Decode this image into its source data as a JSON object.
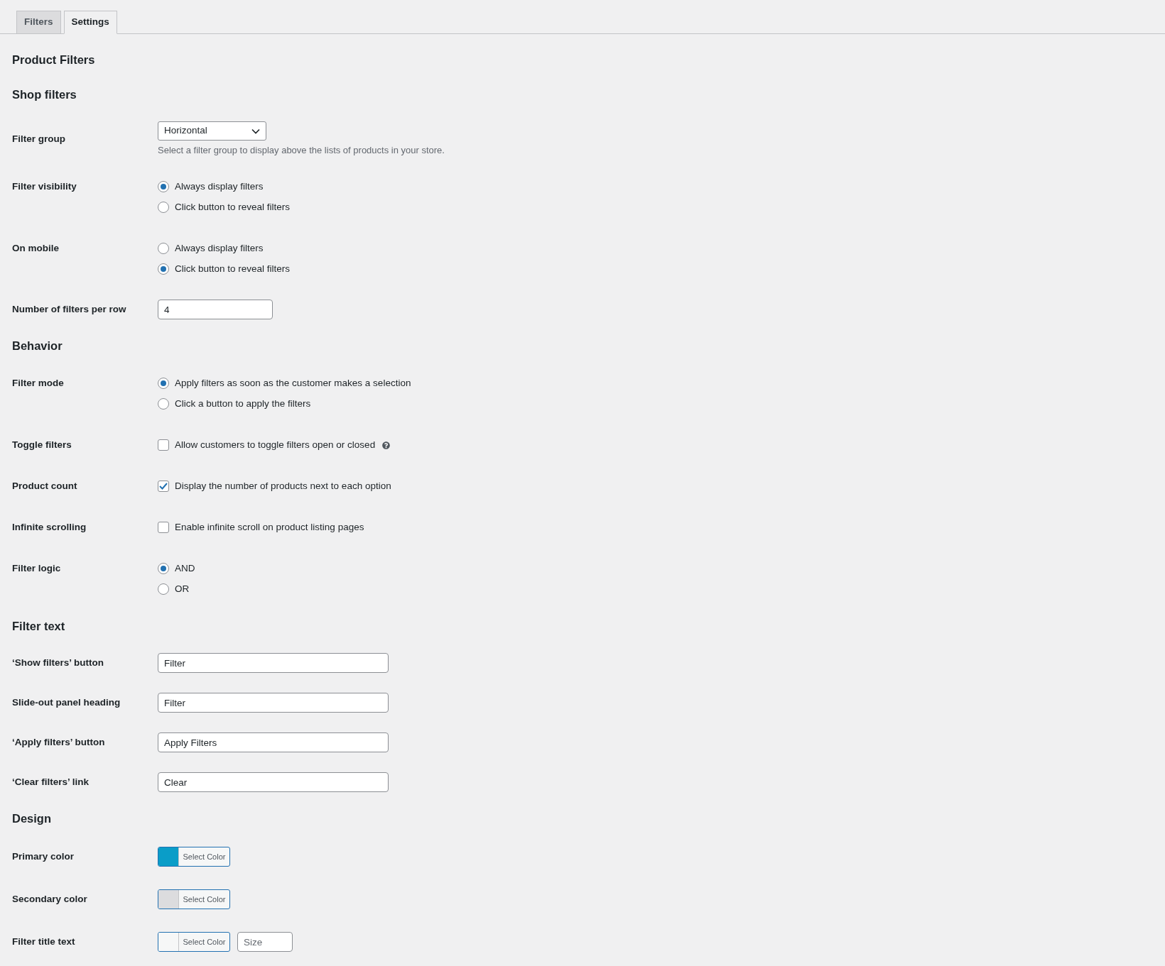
{
  "tabs": [
    {
      "label": "Filters",
      "selected": false
    },
    {
      "label": "Settings",
      "selected": true
    }
  ],
  "title": "Product Filters",
  "sections": [
    {
      "heading": "Shop filters",
      "fields": [
        {
          "kind": "select",
          "label": "Filter group",
          "value": "Horizontal",
          "description": "Select a filter group to display above the lists of products in your store."
        },
        {
          "kind": "radio",
          "label": "Filter visibility",
          "options": [
            {
              "label": "Always display filters",
              "selected": true
            },
            {
              "label": "Click button to reveal filters",
              "selected": false
            }
          ]
        },
        {
          "kind": "radio",
          "label": "On mobile",
          "options": [
            {
              "label": "Always display filters",
              "selected": false
            },
            {
              "label": "Click button to reveal filters",
              "selected": true
            }
          ]
        },
        {
          "kind": "number",
          "label": "Number of filters per row",
          "value": "4"
        }
      ]
    },
    {
      "heading": "Behavior",
      "fields": [
        {
          "kind": "radio",
          "label": "Filter mode",
          "options": [
            {
              "label": "Apply filters as soon as the customer makes a selection",
              "selected": true
            },
            {
              "label": "Click a button to apply the filters",
              "selected": false
            }
          ]
        },
        {
          "kind": "checkbox",
          "label": "Toggle filters",
          "option": "Allow customers to toggle filters open or closed",
          "checked": false,
          "help": true
        },
        {
          "kind": "checkbox",
          "label": "Product count",
          "option": "Display the number of products next to each option",
          "checked": true,
          "help": false
        },
        {
          "kind": "checkbox",
          "label": "Infinite scrolling",
          "option": "Enable infinite scroll on product listing pages",
          "checked": false,
          "help": false
        },
        {
          "kind": "radio",
          "label": "Filter logic",
          "options": [
            {
              "label": "AND",
              "selected": true
            },
            {
              "label": "OR",
              "selected": false
            }
          ]
        }
      ]
    },
    {
      "heading": "Filter text",
      "fields": [
        {
          "kind": "text",
          "label": "‘Show filters’ button",
          "value": "Filter"
        },
        {
          "kind": "text",
          "label": "Slide-out panel heading",
          "value": "Filter"
        },
        {
          "kind": "text",
          "label": "‘Apply filters’ button",
          "value": "Apply Filters"
        },
        {
          "kind": "text",
          "label": "‘Clear filters’ link",
          "value": "Clear"
        }
      ]
    },
    {
      "heading": "Design",
      "fields": [
        {
          "kind": "color",
          "label": "Primary color",
          "button": "Select Color",
          "color": "#0a9dc8"
        },
        {
          "kind": "color",
          "label": "Secondary color",
          "button": "Select Color",
          "color": "#dcdcde"
        },
        {
          "kind": "color",
          "label": "Filter title text",
          "button": "Select Color",
          "color": "#f6f7f7",
          "size_placeholder": "Size"
        }
      ]
    }
  ]
}
